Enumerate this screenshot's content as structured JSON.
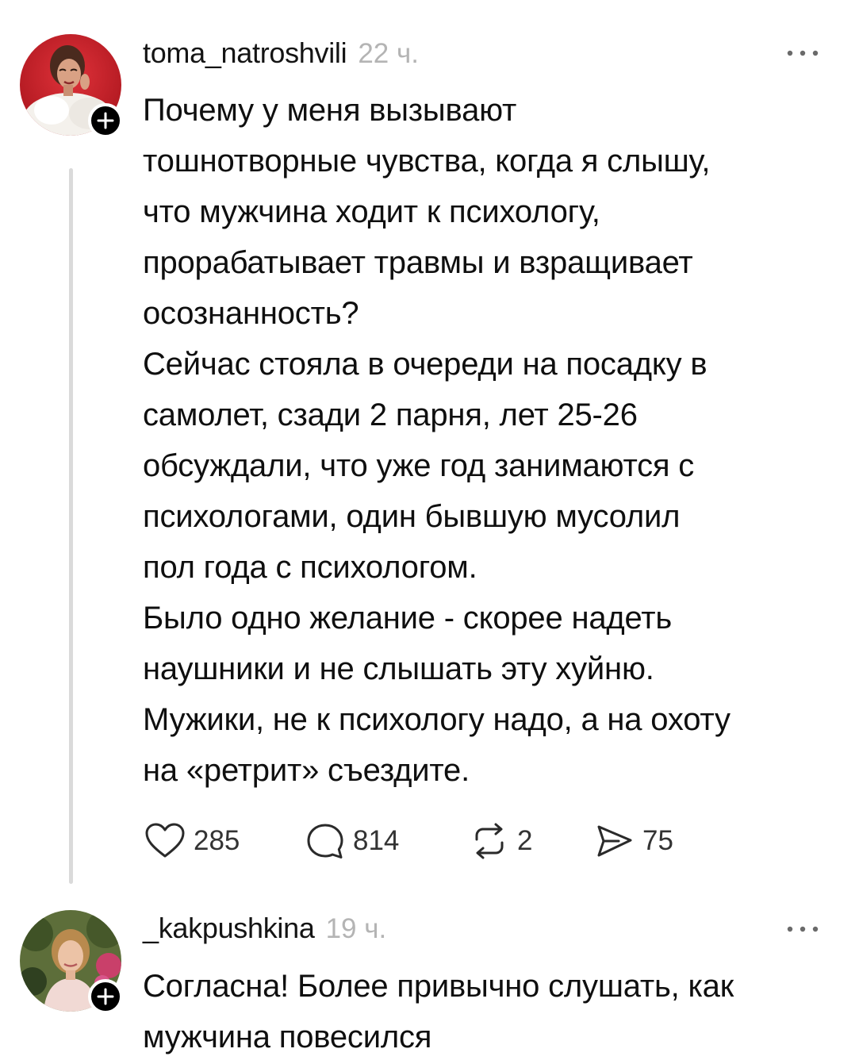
{
  "posts": [
    {
      "username": "toma_natroshvili",
      "time": "22 ч.",
      "body_lines": [
        "Почему у меня вызывают",
        "тошнотворные чувства, когда я слышу,",
        "что мужчина ходит к психологу,",
        "прорабатывает травмы и взращивает",
        "осознанность?",
        "Сейчас стояла в очереди на посадку в",
        "самолет, сзади 2 парня, лет 25-26",
        "обсуждали, что уже год занимаются с",
        "психологами, один бывшую мусолил",
        "пол года с психологом.",
        "Было одно желание - скорее надеть",
        "наушники и не слышать эту хуйню.",
        "Мужики, не к психологу надо, а на охоту",
        "на «ретрит» съездите."
      ],
      "actions": {
        "likes": "285",
        "replies": "814",
        "reposts": "2",
        "shares": "75"
      },
      "icons": [
        "follow-plus-icon",
        "more-options-icon",
        "heart-icon",
        "comment-icon",
        "repost-icon",
        "share-icon"
      ]
    },
    {
      "username": "_kakpushkina",
      "time": "19 ч.",
      "body_lines": [
        "Согласна! Более привычно слушать, как",
        "мужчина повесился"
      ],
      "icons": [
        "follow-plus-icon",
        "more-options-icon"
      ]
    }
  ],
  "colors": {
    "text": "#0f0f0f",
    "muted": "#b4b4b4",
    "thread_line": "#dadada",
    "badge": "#000000"
  }
}
